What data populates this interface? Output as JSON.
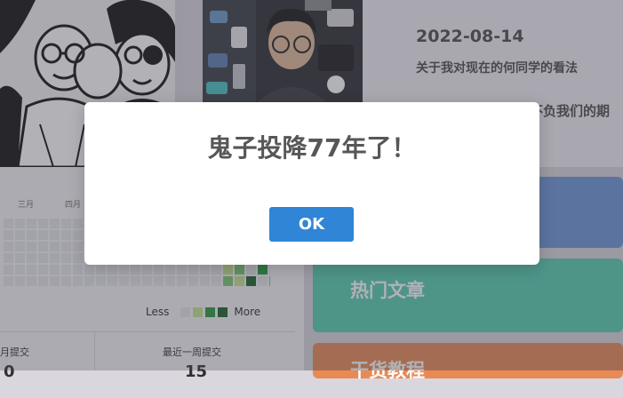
{
  "article": {
    "date": "2022-08-14",
    "title": "关于我对现在的何同学的看法",
    "tail_text": "不负我们的期"
  },
  "contributions": {
    "months": [
      "三月",
      "四月"
    ],
    "legend_less": "Less",
    "legend_more": "More",
    "stat_left_label": "月提交",
    "stat_right_label": "最近一周提交",
    "stat_left_value": "0",
    "stat_right_value": "15",
    "colors": [
      "#e6e6e8",
      "#c6e48b",
      "#7bc96f",
      "#239a3b",
      "#196127"
    ]
  },
  "panels": {
    "hot_articles": "热门文章",
    "tutorials": "干货教程"
  },
  "dialog": {
    "message": "鬼子投降77年了！",
    "ok_label": "OK",
    "accent": "#3085d6"
  }
}
